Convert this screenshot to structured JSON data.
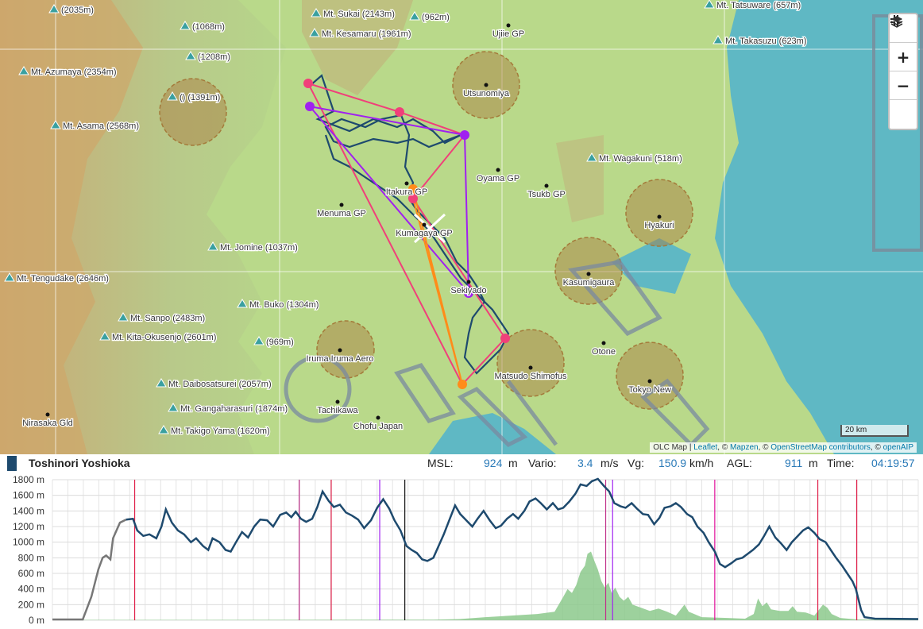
{
  "map": {
    "labels": [
      {
        "text": "(2035m)",
        "kind": "peak"
      },
      {
        "text": "Mt. Sukai (2143m)",
        "kind": "peak"
      },
      {
        "text": "(962m)",
        "kind": "peak"
      },
      {
        "text": "Ujiie GP",
        "kind": "airfield"
      },
      {
        "text": "Mt. Tatsuware (657m)",
        "kind": "peak"
      },
      {
        "text": "(1068m)",
        "kind": "peak"
      },
      {
        "text": "Mt. Kesamaru (1961m)",
        "kind": "peak"
      },
      {
        "text": "Mt. Takasuzu (623m)",
        "kind": "peak"
      },
      {
        "text": "(1208m)",
        "kind": "peak"
      },
      {
        "text": "Mt. Azumaya (2354m)",
        "kind": "peak"
      },
      {
        "text": "Utsunomiya",
        "kind": "airfield"
      },
      {
        "text": "() (1391m)",
        "kind": "peak"
      },
      {
        "text": "Mt. Asama (2568m)",
        "kind": "peak"
      },
      {
        "text": "Mt. Wagakuni (518m)",
        "kind": "peak"
      },
      {
        "text": "Oyama GP",
        "kind": "airfield"
      },
      {
        "text": "Itakura GP",
        "kind": "airfield"
      },
      {
        "text": "Tsukb GP",
        "kind": "airfield"
      },
      {
        "text": "Menuma GP",
        "kind": "airfield"
      },
      {
        "text": "Hyakuri",
        "kind": "airfield"
      },
      {
        "text": "Kumagaya GP",
        "kind": "airfield"
      },
      {
        "text": "Mt. Jomine (1037m)",
        "kind": "peak"
      },
      {
        "text": "Kasumigaura",
        "kind": "airfield"
      },
      {
        "text": "Mt. Tengudake (2646m)",
        "kind": "peak"
      },
      {
        "text": "Sekiyado",
        "kind": "airfield"
      },
      {
        "text": "Mt. Buko (1304m)",
        "kind": "peak"
      },
      {
        "text": "Mt. Sanpo (2483m)",
        "kind": "peak"
      },
      {
        "text": "Mt. Kita-Okusenjo (2601m)",
        "kind": "peak"
      },
      {
        "text": "(969m)",
        "kind": "peak"
      },
      {
        "text": "Otone",
        "kind": "airfield"
      },
      {
        "text": "Iruma Iruma Aero",
        "kind": "airfield"
      },
      {
        "text": "Matsudo Shimofus",
        "kind": "airfield"
      },
      {
        "text": "Tokyo New",
        "kind": "airfield"
      },
      {
        "text": "Mt. Daibosatsurei (2057m)",
        "kind": "peak"
      },
      {
        "text": "Tachikawa",
        "kind": "airfield"
      },
      {
        "text": "Mt. Gangaharasuri (1874m)",
        "kind": "peak"
      },
      {
        "text": "Chofu Japan",
        "kind": "airfield"
      },
      {
        "text": "Nirasaka Gld",
        "kind": "airfield"
      },
      {
        "text": "Mt. Takigo Yama (1620m)",
        "kind": "peak"
      }
    ],
    "scale_text": "20 km",
    "attribution": {
      "olc": "OLC Map",
      "sep": "|",
      "leaflet": "Leaflet",
      "copy1": ", ©",
      "mapzen": "Mapzen",
      "copy2": ", ©",
      "osm": "OpenStreetMap contributors",
      "copy3": ", ©",
      "openaip": "openAIP"
    },
    "controls": {
      "fullscreen_icon": "exit-fullscreen-icon",
      "zoom_in": "+",
      "zoom_out": "−",
      "layers_icon": "layers-icon"
    },
    "colors": {
      "track": "#1e4a6e",
      "route_pink": "#f0407a",
      "route_purple": "#a020f0",
      "route_orange": "#ff8c1a",
      "airspace": "rgba(170,120,60,0.45)"
    }
  },
  "info": {
    "pilot": "Toshinori Yoshioka",
    "msl_label": "MSL:",
    "msl_value": "924",
    "msl_unit": "m",
    "vario_label": "Vario:",
    "vario_value": "3.4",
    "vario_unit": "m/s",
    "vg_label": "Vg:",
    "vg_value": "150.9",
    "vg_unit": "km/h",
    "agl_label": "AGL:",
    "agl_value": "911",
    "agl_unit": "m",
    "time_label": "Time:",
    "time_value": "04:19:57"
  },
  "chart_data": {
    "type": "line",
    "ylim": [
      0,
      1800
    ],
    "y_ticks": [
      "0 m",
      "200 m",
      "400 m",
      "600 m",
      "800 m",
      "1000 m",
      "1200 m",
      "1400 m",
      "1600 m",
      "1800 m"
    ],
    "x_range": [
      0,
      100
    ],
    "series": [],
    "altitude": [
      [
        0,
        10
      ],
      [
        3.5,
        10
      ],
      [
        4.5,
        300
      ],
      [
        5.3,
        650
      ],
      [
        5.8,
        800
      ],
      [
        6.2,
        830
      ],
      [
        6.7,
        780
      ],
      [
        7,
        1050
      ],
      [
        7.8,
        1250
      ],
      [
        8.5,
        1290
      ],
      [
        9.3,
        1300
      ],
      [
        9.8,
        1150
      ],
      [
        10.5,
        1080
      ],
      [
        11.2,
        1100
      ],
      [
        12,
        1050
      ],
      [
        12.6,
        1200
      ],
      [
        13.1,
        1420
      ],
      [
        13.8,
        1250
      ],
      [
        14.5,
        1150
      ],
      [
        15.2,
        1100
      ],
      [
        16,
        1000
      ],
      [
        16.6,
        1050
      ],
      [
        17.4,
        950
      ],
      [
        18,
        900
      ],
      [
        18.5,
        1050
      ],
      [
        19.3,
        1000
      ],
      [
        20,
        900
      ],
      [
        20.6,
        880
      ],
      [
        21.2,
        1000
      ],
      [
        21.9,
        1130
      ],
      [
        22.6,
        1060
      ],
      [
        23.3,
        1200
      ],
      [
        24,
        1290
      ],
      [
        24.8,
        1280
      ],
      [
        25.5,
        1200
      ],
      [
        26.3,
        1350
      ],
      [
        27,
        1380
      ],
      [
        27.6,
        1320
      ],
      [
        28.1,
        1390
      ],
      [
        28.7,
        1300
      ],
      [
        29.3,
        1260
      ],
      [
        30,
        1300
      ],
      [
        30.6,
        1450
      ],
      [
        31.2,
        1650
      ],
      [
        31.9,
        1530
      ],
      [
        32.5,
        1450
      ],
      [
        33.2,
        1480
      ],
      [
        33.9,
        1380
      ],
      [
        34.6,
        1340
      ],
      [
        35.3,
        1290
      ],
      [
        36,
        1180
      ],
      [
        36.8,
        1280
      ],
      [
        37.5,
        1440
      ],
      [
        38.2,
        1550
      ],
      [
        38.9,
        1430
      ],
      [
        39.5,
        1280
      ],
      [
        40.2,
        1150
      ],
      [
        40.9,
        950
      ],
      [
        41.5,
        900
      ],
      [
        42.1,
        860
      ],
      [
        42.7,
        780
      ],
      [
        43.3,
        760
      ],
      [
        44,
        800
      ],
      [
        44.6,
        950
      ],
      [
        45.2,
        1100
      ],
      [
        45.9,
        1300
      ],
      [
        46.5,
        1470
      ],
      [
        47.1,
        1360
      ],
      [
        47.8,
        1280
      ],
      [
        48.5,
        1200
      ],
      [
        49.1,
        1300
      ],
      [
        49.8,
        1400
      ],
      [
        50.5,
        1280
      ],
      [
        51.2,
        1180
      ],
      [
        51.8,
        1210
      ],
      [
        52.5,
        1300
      ],
      [
        53.2,
        1360
      ],
      [
        53.8,
        1300
      ],
      [
        54.5,
        1400
      ],
      [
        55.1,
        1520
      ],
      [
        55.8,
        1560
      ],
      [
        56.4,
        1500
      ],
      [
        57.1,
        1420
      ],
      [
        57.8,
        1500
      ],
      [
        58.4,
        1420
      ],
      [
        59,
        1440
      ],
      [
        59.7,
        1520
      ],
      [
        60.4,
        1620
      ],
      [
        61,
        1740
      ],
      [
        61.7,
        1720
      ],
      [
        62.3,
        1780
      ],
      [
        63,
        1810
      ],
      [
        63.7,
        1720
      ],
      [
        64.3,
        1650
      ],
      [
        64.9,
        1500
      ],
      [
        65.6,
        1460
      ],
      [
        66.2,
        1440
      ],
      [
        66.9,
        1500
      ],
      [
        67.5,
        1430
      ],
      [
        68.2,
        1360
      ],
      [
        68.8,
        1350
      ],
      [
        69.5,
        1230
      ],
      [
        70.1,
        1310
      ],
      [
        70.7,
        1440
      ],
      [
        71.4,
        1460
      ],
      [
        72,
        1500
      ],
      [
        72.6,
        1450
      ],
      [
        73.3,
        1360
      ],
      [
        73.9,
        1320
      ],
      [
        74.5,
        1200
      ],
      [
        75.2,
        1120
      ],
      [
        75.8,
        1000
      ],
      [
        76.5,
        880
      ],
      [
        77.1,
        720
      ],
      [
        77.7,
        680
      ],
      [
        78.4,
        730
      ],
      [
        79,
        780
      ],
      [
        79.7,
        800
      ],
      [
        80.3,
        850
      ],
      [
        80.9,
        900
      ],
      [
        81.6,
        970
      ],
      [
        82.2,
        1080
      ],
      [
        82.8,
        1200
      ],
      [
        83.5,
        1060
      ],
      [
        84.1,
        990
      ],
      [
        84.8,
        900
      ],
      [
        85.4,
        1000
      ],
      [
        86.1,
        1080
      ],
      [
        86.7,
        1150
      ],
      [
        87.3,
        1190
      ],
      [
        88,
        1120
      ],
      [
        88.6,
        1040
      ],
      [
        89.3,
        1000
      ],
      [
        89.9,
        900
      ],
      [
        90.5,
        800
      ],
      [
        91.2,
        700
      ],
      [
        91.8,
        600
      ],
      [
        92.4,
        500
      ],
      [
        92.8,
        400
      ],
      [
        93.4,
        130
      ],
      [
        93.8,
        40
      ],
      [
        95,
        20
      ],
      [
        100,
        15
      ]
    ],
    "ground": [
      [
        0,
        5
      ],
      [
        30,
        6
      ],
      [
        44,
        8
      ],
      [
        47,
        15
      ],
      [
        50,
        40
      ],
      [
        53,
        60
      ],
      [
        56,
        80
      ],
      [
        58,
        110
      ],
      [
        59,
        300
      ],
      [
        59.5,
        400
      ],
      [
        60,
        350
      ],
      [
        60.5,
        450
      ],
      [
        61,
        620
      ],
      [
        61.5,
        700
      ],
      [
        61.8,
        850
      ],
      [
        62.2,
        880
      ],
      [
        62.6,
        760
      ],
      [
        63,
        650
      ],
      [
        63.4,
        500
      ],
      [
        63.8,
        420
      ],
      [
        64.2,
        480
      ],
      [
        64.6,
        350
      ],
      [
        65,
        420
      ],
      [
        65.5,
        300
      ],
      [
        66,
        250
      ],
      [
        66.5,
        300
      ],
      [
        67,
        200
      ],
      [
        68,
        160
      ],
      [
        69,
        120
      ],
      [
        70,
        150
      ],
      [
        71,
        110
      ],
      [
        72,
        60
      ],
      [
        73,
        200
      ],
      [
        73.5,
        110
      ],
      [
        75,
        40
      ],
      [
        78,
        30
      ],
      [
        80,
        20
      ],
      [
        81,
        80
      ],
      [
        81.5,
        280
      ],
      [
        82,
        180
      ],
      [
        82.5,
        230
      ],
      [
        83,
        140
      ],
      [
        84,
        120
      ],
      [
        85,
        120
      ],
      [
        85.5,
        180
      ],
      [
        86,
        110
      ],
      [
        87,
        100
      ],
      [
        88,
        60
      ],
      [
        89,
        200
      ],
      [
        89.5,
        160
      ],
      [
        90,
        80
      ],
      [
        91,
        30
      ],
      [
        93,
        10
      ],
      [
        100,
        5
      ]
    ],
    "vlines": [
      {
        "x": 9.5,
        "color": "#e0204a"
      },
      {
        "x": 28.5,
        "color": "#c0308a"
      },
      {
        "x": 32.2,
        "color": "#e0204a"
      },
      {
        "x": 37.8,
        "color": "#a020f0"
      },
      {
        "x": 40.7,
        "color": "#111111"
      },
      {
        "x": 63.9,
        "color": "#c0308a"
      },
      {
        "x": 64.7,
        "color": "#a020f0"
      },
      {
        "x": 76.5,
        "color": "#e0109a"
      },
      {
        "x": 88.4,
        "color": "#e0204a"
      },
      {
        "x": 92.9,
        "color": "#e0204a"
      }
    ]
  }
}
